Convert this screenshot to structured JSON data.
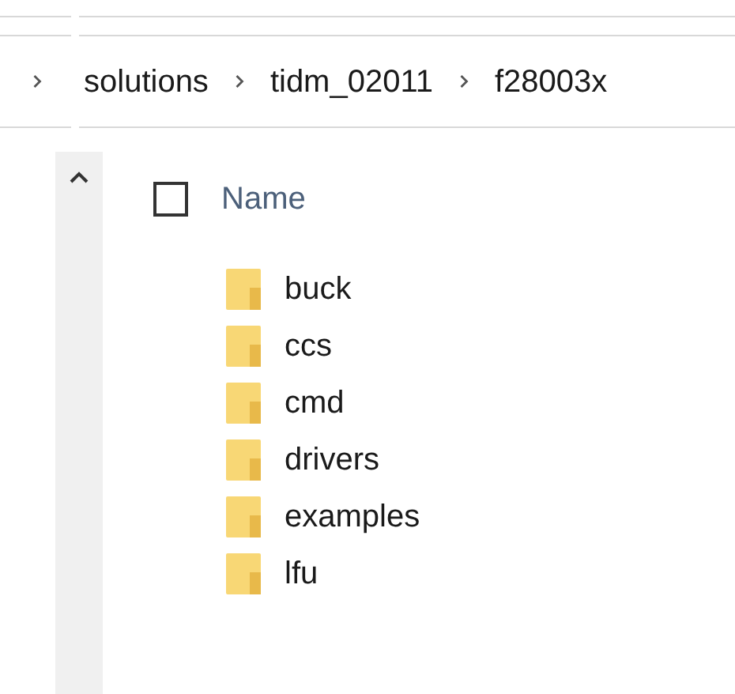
{
  "breadcrumb": [
    {
      "label": "solutions"
    },
    {
      "label": "tidm_02011"
    },
    {
      "label": "f28003x"
    }
  ],
  "header": {
    "column": "Name",
    "checked": false
  },
  "folders": [
    {
      "name": "buck"
    },
    {
      "name": "ccs"
    },
    {
      "name": "cmd"
    },
    {
      "name": "drivers"
    },
    {
      "name": "examples"
    },
    {
      "name": "lfu"
    }
  ]
}
